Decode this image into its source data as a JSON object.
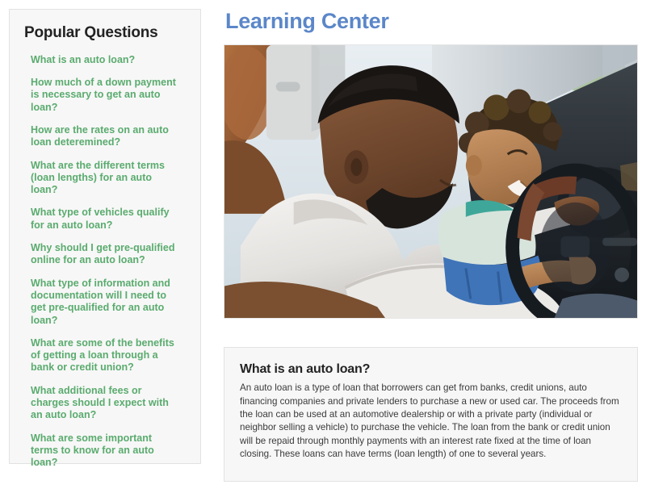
{
  "sidebar": {
    "title": "Popular Questions",
    "questions": [
      "What is an auto loan?",
      "How much of a down payment is necessary to get an auto loan?",
      "How are the rates on an auto loan deteremined?",
      "What are the different terms (loan lengths) for an auto loan?",
      "What type of vehicles qualify for an auto loan?",
      "Why should I get pre-qualified online for an auto loan?",
      "What type of information and documentation will I need to get pre-qualified for an auto loan?",
      "What are some of the benefits of getting a loan through a bank or credit union?",
      "What additional fees or charges should I expect with an auto loan?",
      "What are some important terms to know for an auto loan?"
    ]
  },
  "main": {
    "title": "Learning Center",
    "hero_image_alt": "Man in white hoodie sitting in a car with a smiling toddler on his lap holding the steering wheel",
    "article": {
      "heading": "What is an auto loan?",
      "body": "An auto loan is a type of loan that borrowers can get from banks, credit unions, auto financing companies and private lenders to purchase a new or used car. The proceeds from the loan can be used at an automotive dealership or with a private party (individual or neighbor selling a vehicle) to purchase the vehicle. The loan from the bank or credit union will be repaid through monthly payments with an interest rate fixed at the time of loan closing. These loans can have terms (loan length) of one to several years."
    }
  },
  "colors": {
    "link_green": "#5aab6e",
    "title_blue": "#5b87c9",
    "panel_bg": "#f7f7f7",
    "panel_border": "#e2e2e2",
    "text_dark": "#232323"
  }
}
